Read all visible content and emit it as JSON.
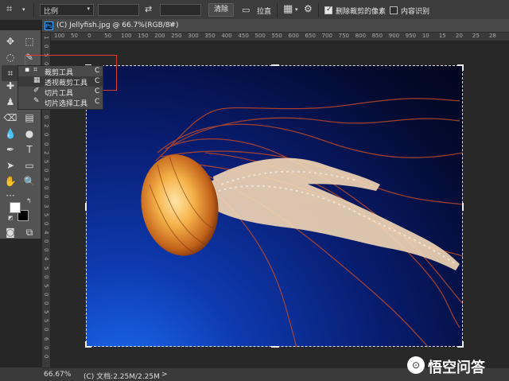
{
  "options_bar": {
    "tool_icon": "crop-icon",
    "ratio_select": "比例",
    "swap_icon": "swap-icon",
    "clear_button": "清除",
    "straighten_label": "拉直",
    "grid_icon": "overlay-grid-icon",
    "settings_icon": "gear-icon",
    "delete_cropped": {
      "label": "删除裁剪的像素",
      "checked": true
    },
    "content_aware": {
      "label": "内容识别",
      "checked": false
    }
  },
  "document": {
    "tab_badge": "Ps",
    "tab_title": "(C) Jellyfish.jpg @ 66.7%(RGB/8#)",
    "ruler_top_ticks": [
      "100",
      "50",
      "0",
      "50",
      "100",
      "150",
      "200",
      "250",
      "300",
      "350",
      "400",
      "450",
      "500",
      "550",
      "600",
      "650",
      "700",
      "750",
      "800",
      "850",
      "900",
      "950",
      "10",
      "15",
      "20",
      "25",
      "28"
    ],
    "ruler_left_ticks": [
      "1",
      "0",
      "5",
      "0",
      "1",
      "0",
      "0",
      "1",
      "5",
      "0",
      "2",
      "0",
      "0",
      "2",
      "5",
      "0",
      "3",
      "0",
      "0",
      "3",
      "5",
      "0",
      "4",
      "0",
      "0",
      "4",
      "5",
      "0",
      "5",
      "0",
      "0",
      "5",
      "5",
      "0",
      "6",
      "0",
      "0"
    ]
  },
  "flyout": {
    "items": [
      {
        "icon": "crop-icon",
        "label": "裁剪工具",
        "key": "C",
        "active": true
      },
      {
        "icon": "perspective-crop-icon",
        "label": "透视裁剪工具",
        "key": "C",
        "active": false
      },
      {
        "icon": "slice-icon",
        "label": "切片工具",
        "key": "C",
        "active": false
      },
      {
        "icon": "slice-select-icon",
        "label": "切片选择工具",
        "key": "C",
        "active": false
      }
    ]
  },
  "status": {
    "zoom": "66.67%",
    "doc_info": "(C) 文档:2.25M/2.25M",
    "arrow": ">"
  },
  "watermark": {
    "text": "悟空问答",
    "icon": "wukong-logo-icon"
  },
  "colors": {
    "foreground": "#ffffff",
    "background": "#000000",
    "highlight_box": "#d83a3a"
  }
}
